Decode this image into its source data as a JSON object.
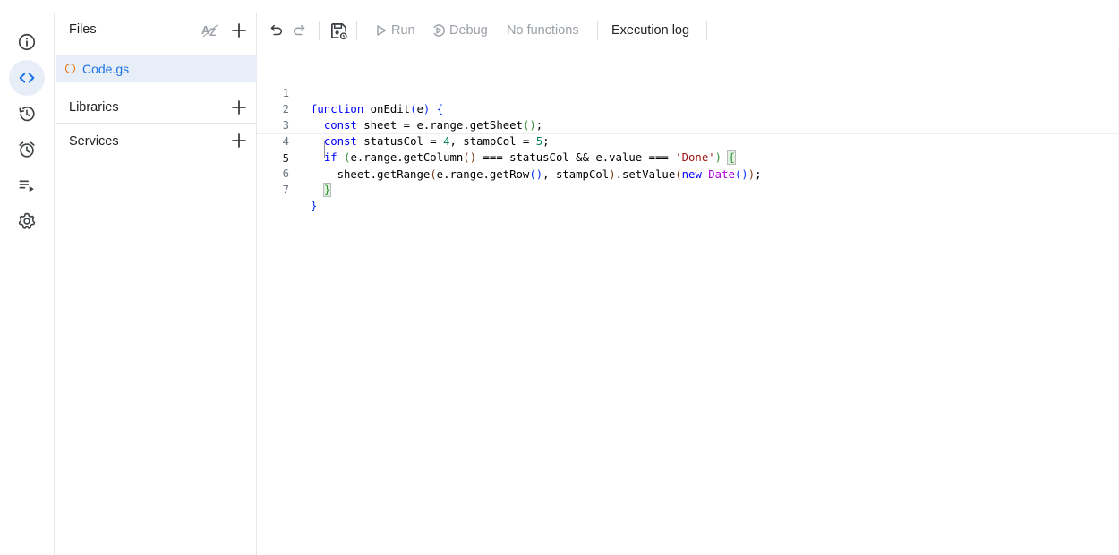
{
  "rail": {
    "items": [
      {
        "name": "overview",
        "icon": "info-icon"
      },
      {
        "name": "editor",
        "icon": "code-icon",
        "active": true
      },
      {
        "name": "executions-history",
        "icon": "history-icon"
      },
      {
        "name": "triggers",
        "icon": "alarm-clock-icon"
      },
      {
        "name": "executions",
        "icon": "playlist-play-icon"
      },
      {
        "name": "settings",
        "icon": "gear-icon"
      }
    ]
  },
  "files_panel": {
    "title": "Files",
    "sort_icon": "sort-az-icon",
    "files": [
      {
        "name": "Code.gs",
        "status": "unsaved"
      }
    ],
    "libraries_label": "Libraries",
    "services_label": "Services"
  },
  "toolbar": {
    "run_label": "Run",
    "debug_label": "Debug",
    "function_select_label": "No functions",
    "execution_log_label": "Execution log"
  },
  "editor": {
    "current_line": 5,
    "lines": [
      {
        "n": "1",
        "text": "function onEdit(e) {"
      },
      {
        "n": "2",
        "text": "  const sheet = e.range.getSheet();"
      },
      {
        "n": "3",
        "text": "  const statusCol = 4, stampCol = 5;"
      },
      {
        "n": "4",
        "text": "  if (e.range.getColumn() === statusCol && e.value === 'Done') {"
      },
      {
        "n": "5",
        "text": "    sheet.getRange(e.range.getRow(), stampCol).setValue(new Date());"
      },
      {
        "n": "6",
        "text": "  }"
      },
      {
        "n": "7",
        "text": "}"
      }
    ]
  },
  "colors": {
    "accent": "#1a73e8",
    "active_bg": "#e8eef8",
    "file_unsaved": "#e8710a",
    "disabled_text": "#9aa0a6"
  }
}
